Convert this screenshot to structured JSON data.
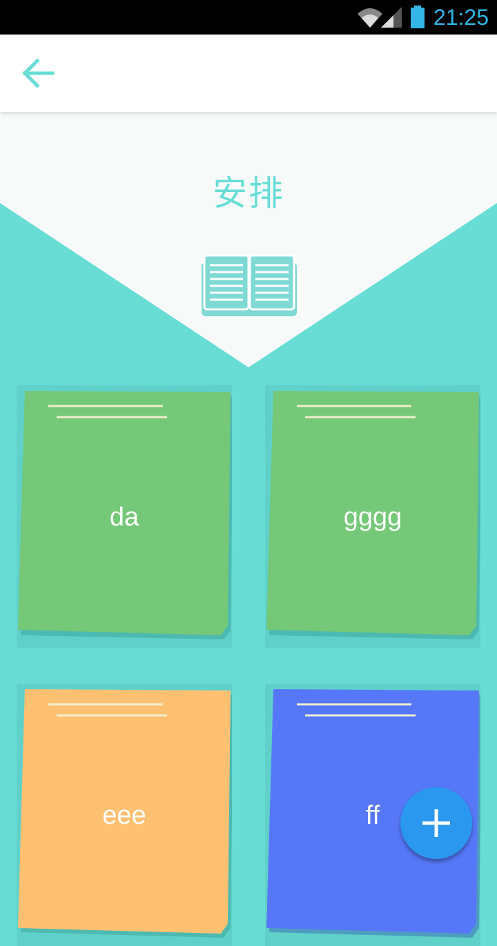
{
  "status_bar": {
    "time": "21:25",
    "icons": [
      "wifi-icon",
      "signal-icon",
      "battery-icon"
    ],
    "color": "#33b5e5"
  },
  "app_bar": {
    "back_icon": "arrow-left-icon"
  },
  "header": {
    "title": "安排",
    "icon": "book-icon"
  },
  "notes": [
    {
      "label": "da",
      "color": "#74c877"
    },
    {
      "label": "gggg",
      "color": "#74c877"
    },
    {
      "label": "eee",
      "color": "#ffc072"
    },
    {
      "label": "ff",
      "color": "#5678f8"
    }
  ],
  "fab": {
    "icon": "plus-icon",
    "color": "#2b98f0"
  },
  "colors": {
    "background": "#67ddd6",
    "accent": "#67ddd6"
  }
}
